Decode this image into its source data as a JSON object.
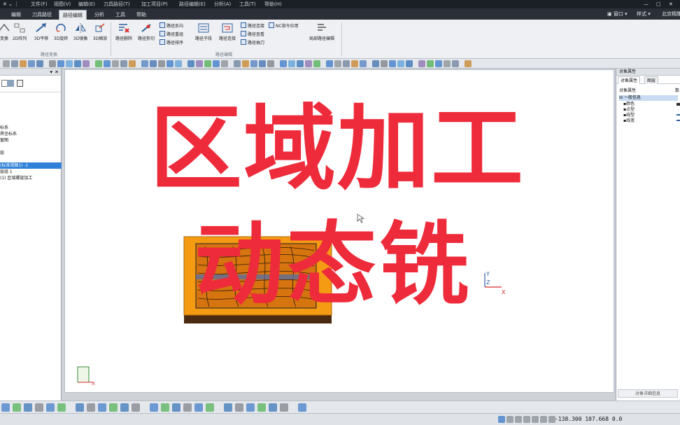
{
  "titlebar": {
    "menus": [
      "文件(F)",
      "视图(V)",
      "编辑(E)",
      "刀具路径(T)",
      "加工项目(P)",
      "路径编辑(E)",
      "分析(A)",
      "工具(T)",
      "帮助(H)"
    ]
  },
  "tabs": [
    "编辑",
    "刀具路径",
    "路径编辑",
    "分析",
    "工具",
    "帮助"
  ],
  "active_tab_index": 2,
  "tabrow_right": {
    "window": "窗口",
    "style": "样式",
    "brand": "北京精雕"
  },
  "ribbon": {
    "big_buttons": [
      {
        "label": "变换",
        "icon": "transform-icon"
      },
      {
        "label": "2D阵列",
        "icon": "array-icon"
      },
      {
        "label": "3D平移",
        "icon": "translate-icon"
      },
      {
        "label": "3D旋转",
        "icon": "rotate-icon"
      },
      {
        "label": "3D镜像",
        "icon": "mirror-icon"
      },
      {
        "label": "3D缩放",
        "icon": "scale-icon"
      },
      {
        "label": "路径删除",
        "icon": "delete-path-icon"
      },
      {
        "label": "路径剪切",
        "icon": "cut-path-icon"
      },
      {
        "label": "路径子段",
        "icon": "subsegment-icon"
      },
      {
        "label": "路径连接",
        "icon": "connect-path-icon"
      },
      {
        "label": "局部路径编辑",
        "icon": "local-edit-icon"
      }
    ],
    "small_buttons_a": [
      "路径反向",
      "路径重组",
      "路径排序"
    ],
    "small_buttons_b": [
      "路径连接",
      "路径查看",
      "路径抽刀"
    ],
    "small_button_c": "NC指令应用",
    "group_labels": [
      "路径变换",
      "路径编辑"
    ]
  },
  "tree": {
    "items": [
      "标系",
      "界坐标系",
      "窗图",
      "",
      "层",
      "",
      "(标准视图1) -1",
      "层组 1",
      "(1) 区域螺旋加工"
    ],
    "selected_index": 6
  },
  "overlay": {
    "line1": "区域加工",
    "line2": "动态铣"
  },
  "axis": {
    "x": "X",
    "y": "Y",
    "z": "Z"
  },
  "rightpanel": {
    "title": "对象属性",
    "tabs": [
      "对象属性",
      "图层"
    ],
    "header": "对象属性",
    "header_right": "数",
    "group": "一般信息",
    "rows": [
      "颜色",
      "点型",
      "线型",
      "线宽"
    ],
    "bottom": "对象详细信息"
  },
  "status": {
    "coords": "-138.300  107.668  0.0"
  }
}
